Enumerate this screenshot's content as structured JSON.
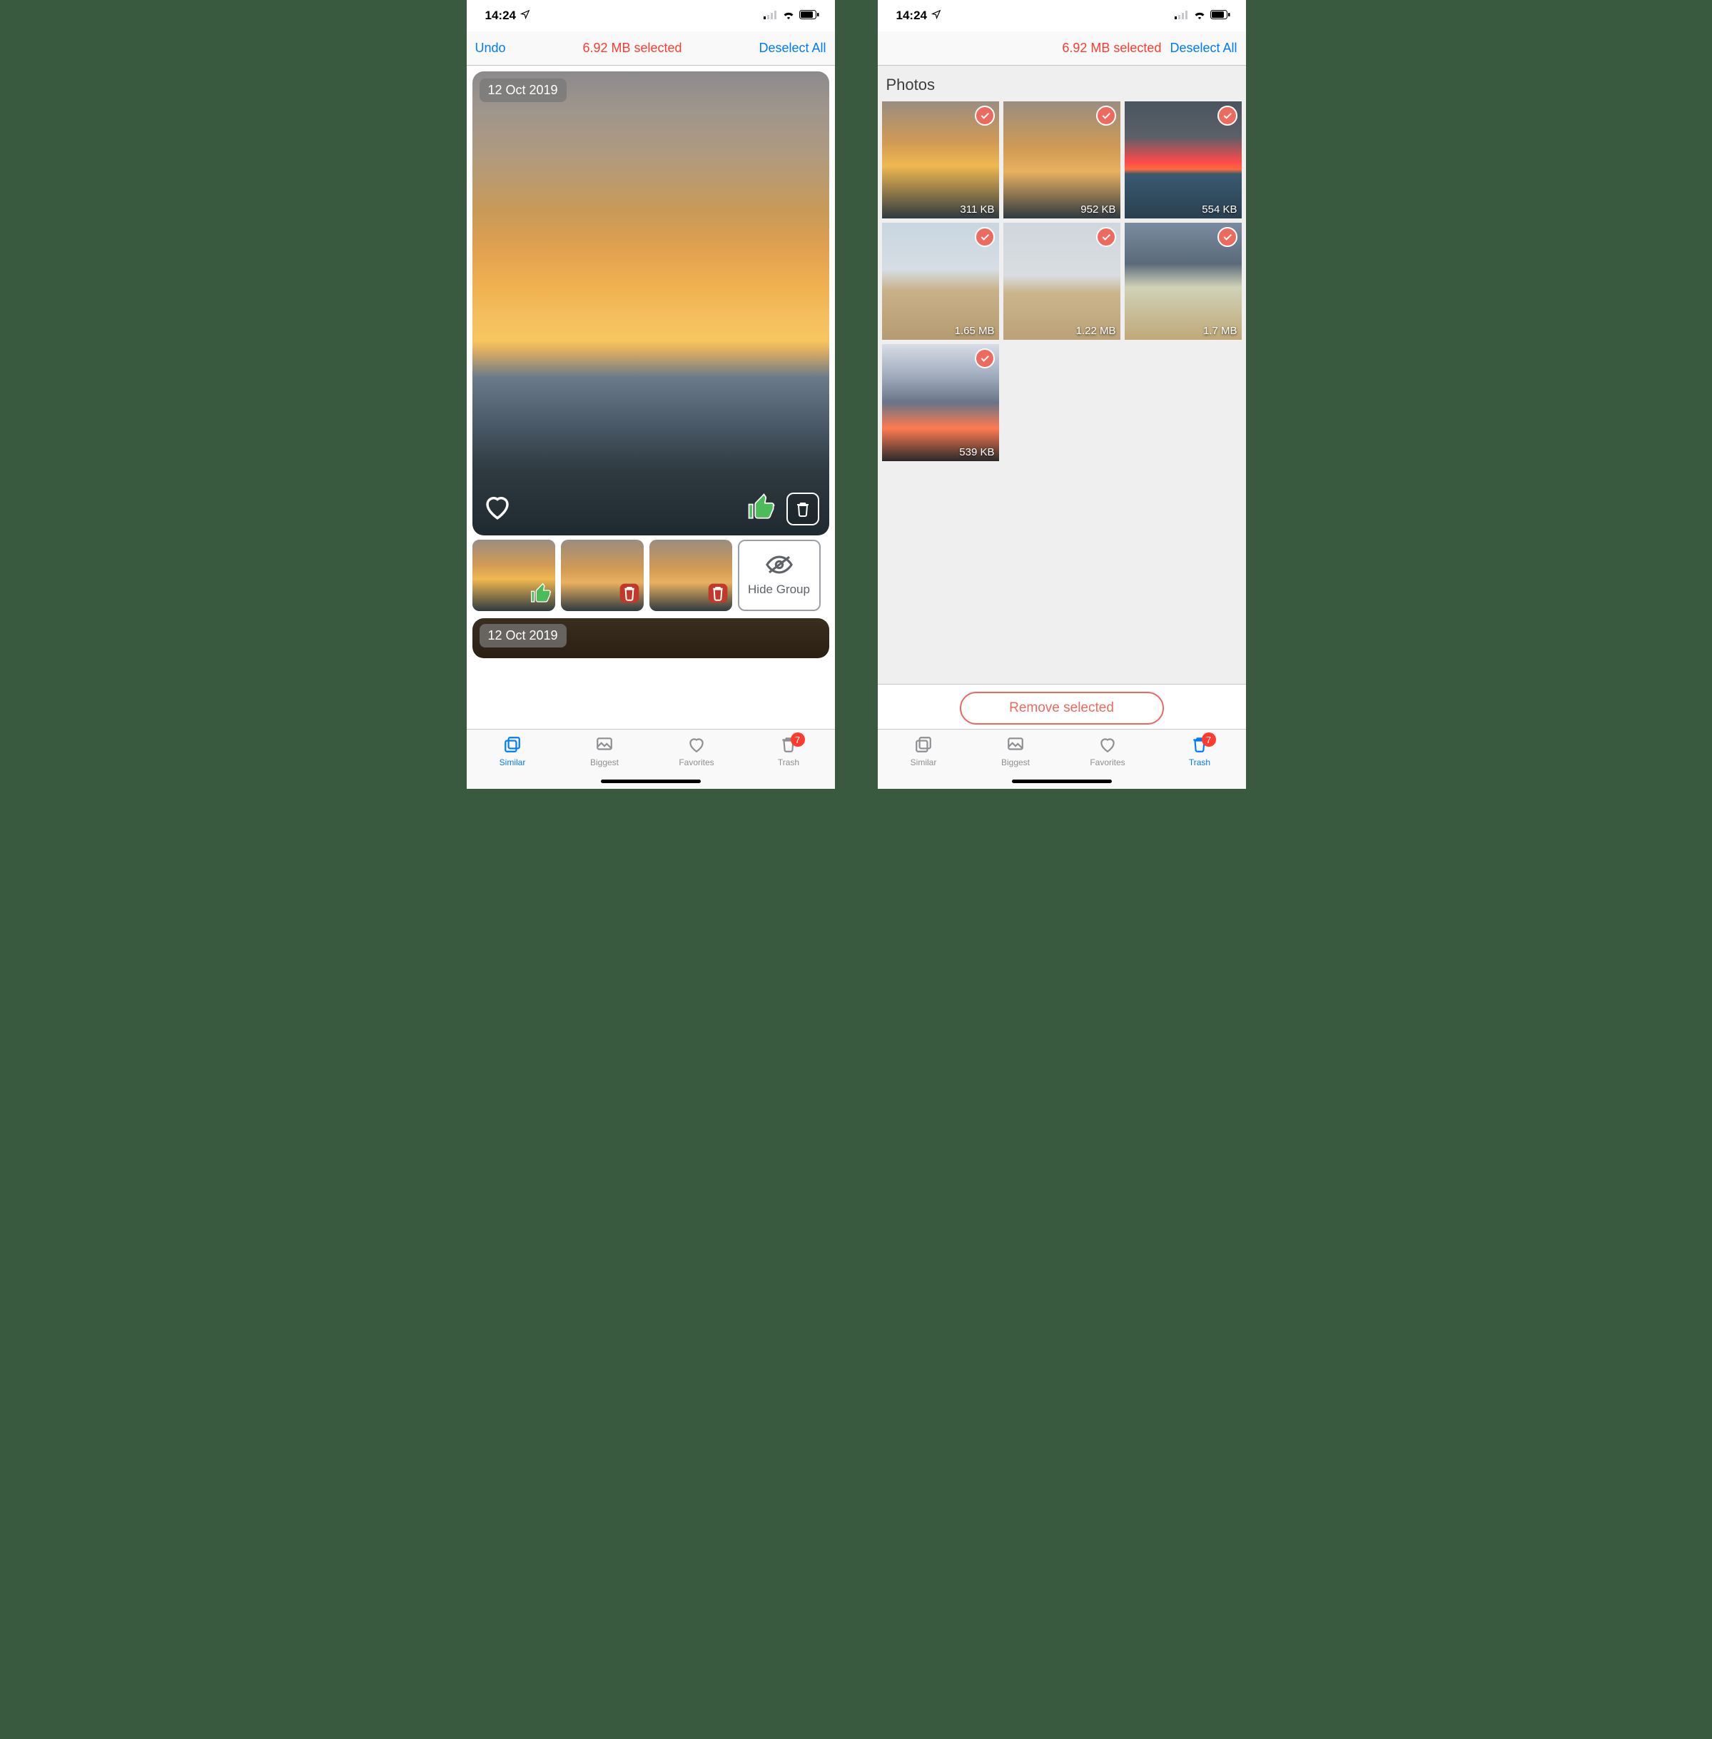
{
  "status": {
    "time": "14:24",
    "signal_label": "cellular-signal",
    "wifi_label": "wifi",
    "battery_label": "battery"
  },
  "left": {
    "nav": {
      "undo": "Undo",
      "selected": "6.92 MB selected",
      "deselect": "Deselect All"
    },
    "card": {
      "date": "12 Oct 2019"
    },
    "hide_group": "Hide Group",
    "next_card_date": "12 Oct 2019",
    "tabs": {
      "similar": "Similar",
      "biggest": "Biggest",
      "favorites": "Favorites",
      "trash": "Trash",
      "trash_badge": "7"
    }
  },
  "right": {
    "nav": {
      "selected": "6.92 MB selected",
      "deselect": "Deselect All"
    },
    "section": "Photos",
    "cells": [
      {
        "size": "311 KB"
      },
      {
        "size": "952 KB"
      },
      {
        "size": "554 KB"
      },
      {
        "size": "1.65 MB"
      },
      {
        "size": "1.22 MB"
      },
      {
        "size": "1.7 MB"
      },
      {
        "size": "539 KB"
      }
    ],
    "remove": "Remove selected",
    "tabs": {
      "similar": "Similar",
      "biggest": "Biggest",
      "favorites": "Favorites",
      "trash": "Trash",
      "trash_badge": "7"
    }
  }
}
